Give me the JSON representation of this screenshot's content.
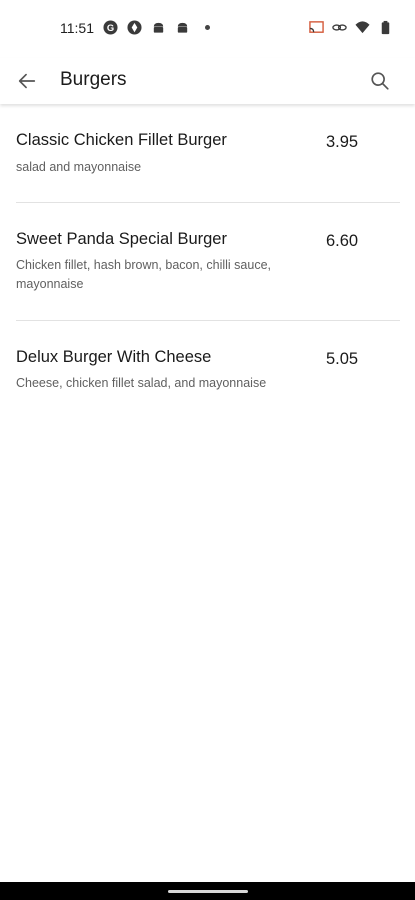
{
  "status_bar": {
    "time": "11:51",
    "left_icons": [
      "g-circle-icon",
      "photos-icon",
      "android-icon",
      "android-icon",
      "dot-icon"
    ],
    "right_icons": [
      "cast-icon",
      "link-icon",
      "wifi-icon",
      "battery-icon"
    ]
  },
  "app_bar": {
    "title": "Burgers",
    "back_icon": "arrow-back-icon",
    "search_icon": "search-icon"
  },
  "menu": {
    "items": [
      {
        "name": "Classic Chicken Fillet Burger",
        "description": "salad and mayonnaise",
        "price": "3.95"
      },
      {
        "name": "Sweet Panda Special Burger",
        "description": "Chicken fillet, hash brown, bacon, chilli sauce, mayonnaise",
        "price": "6.60"
      },
      {
        "name": "Delux Burger With Cheese",
        "description": "Cheese, chicken fillet salad, and mayonnaise",
        "price": "5.05"
      }
    ]
  }
}
